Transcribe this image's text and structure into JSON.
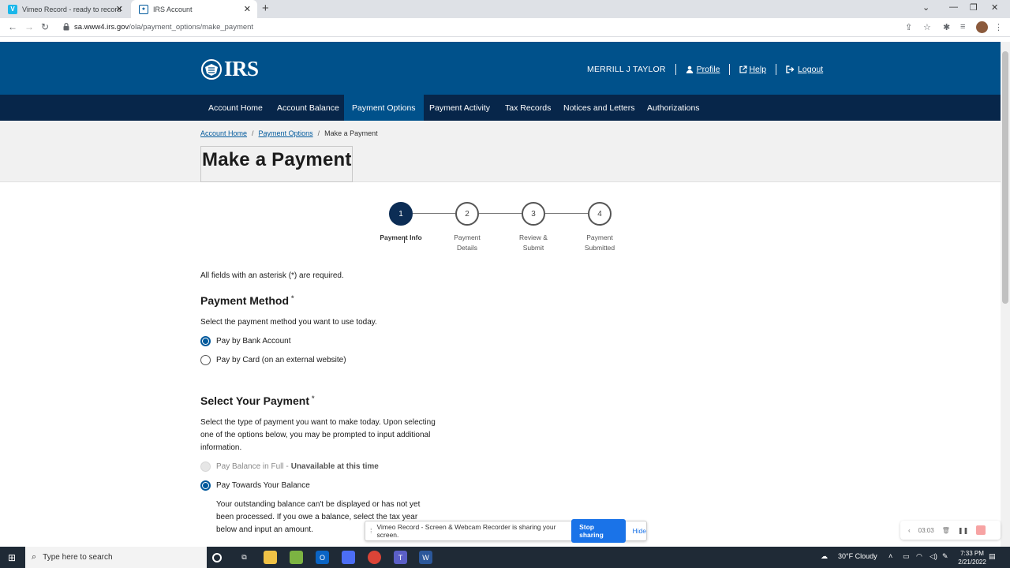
{
  "browser": {
    "tabs": [
      {
        "label": "Vimeo Record - ready to record",
        "favicon": "V",
        "favicon_color": "#1ab7ea"
      },
      {
        "label": "IRS Account",
        "favicon": "IRS",
        "favicon_color": "#00599c"
      }
    ],
    "url_host": "sa.www4.irs.gov",
    "url_path": "/ola/payment_options/make_payment"
  },
  "header": {
    "logo_text": "IRS",
    "user_name": "MERRILL J TAYLOR",
    "profile_label": "Profile",
    "help_label": "Help",
    "logout_label": "Logout"
  },
  "nav": {
    "items": [
      {
        "label": "Account Home"
      },
      {
        "label": "Account Balance"
      },
      {
        "label": "Payment Options",
        "active": true
      },
      {
        "label": "Payment Activity"
      },
      {
        "label": "Tax Records"
      },
      {
        "label": "Notices and Letters"
      },
      {
        "label": "Authorizations"
      }
    ]
  },
  "breadcrumb": {
    "items": [
      "Account Home",
      "Payment Options",
      "Make a Payment"
    ],
    "separator": "/"
  },
  "page_title": "Make a Payment",
  "stepper": {
    "steps": [
      {
        "num": "1",
        "label_line1": "Payment Info",
        "label_line2": "",
        "active": true
      },
      {
        "num": "2",
        "label_line1": "Payment",
        "label_line2": "Details",
        "active": false
      },
      {
        "num": "3",
        "label_line1": "Review &",
        "label_line2": "Submit",
        "active": false
      },
      {
        "num": "4",
        "label_line1": "Payment",
        "label_line2": "Submitted",
        "active": false
      }
    ]
  },
  "form": {
    "required_note": "All fields with an asterisk (*) are required.",
    "payment_method": {
      "title": "Payment Method",
      "asterisk": "*",
      "description": "Select the payment method you want to use today.",
      "options": [
        {
          "label": "Pay by Bank Account",
          "checked": true
        },
        {
          "label": "Pay by Card (on an external website)",
          "checked": false
        }
      ]
    },
    "select_payment": {
      "title": "Select Your Payment",
      "asterisk": "*",
      "description": "Select the type of payment you want to make today. Upon selecting one of the options below, you may be prompted to input additional information.",
      "options": [
        {
          "label": "Pay Balance in Full -",
          "suffix": "Unavailable at this time",
          "disabled": true
        },
        {
          "label": "Pay Towards Your Balance",
          "checked": true
        }
      ],
      "balance_note": "Your outstanding balance can't be displayed or has not yet been processed. If you owe a balance, select the tax year below and input an amount."
    }
  },
  "sharebar": {
    "message": "Vimeo Record - Screen & Webcam Recorder is sharing your screen.",
    "stop_label": "Stop sharing",
    "hide_label": "Hide"
  },
  "recorder": {
    "timer": "03:03"
  },
  "taskbar": {
    "search_placeholder": "Type here to search",
    "weather": "30°F  Cloudy",
    "time": "7:33 PM",
    "date": "2/21/2022"
  }
}
